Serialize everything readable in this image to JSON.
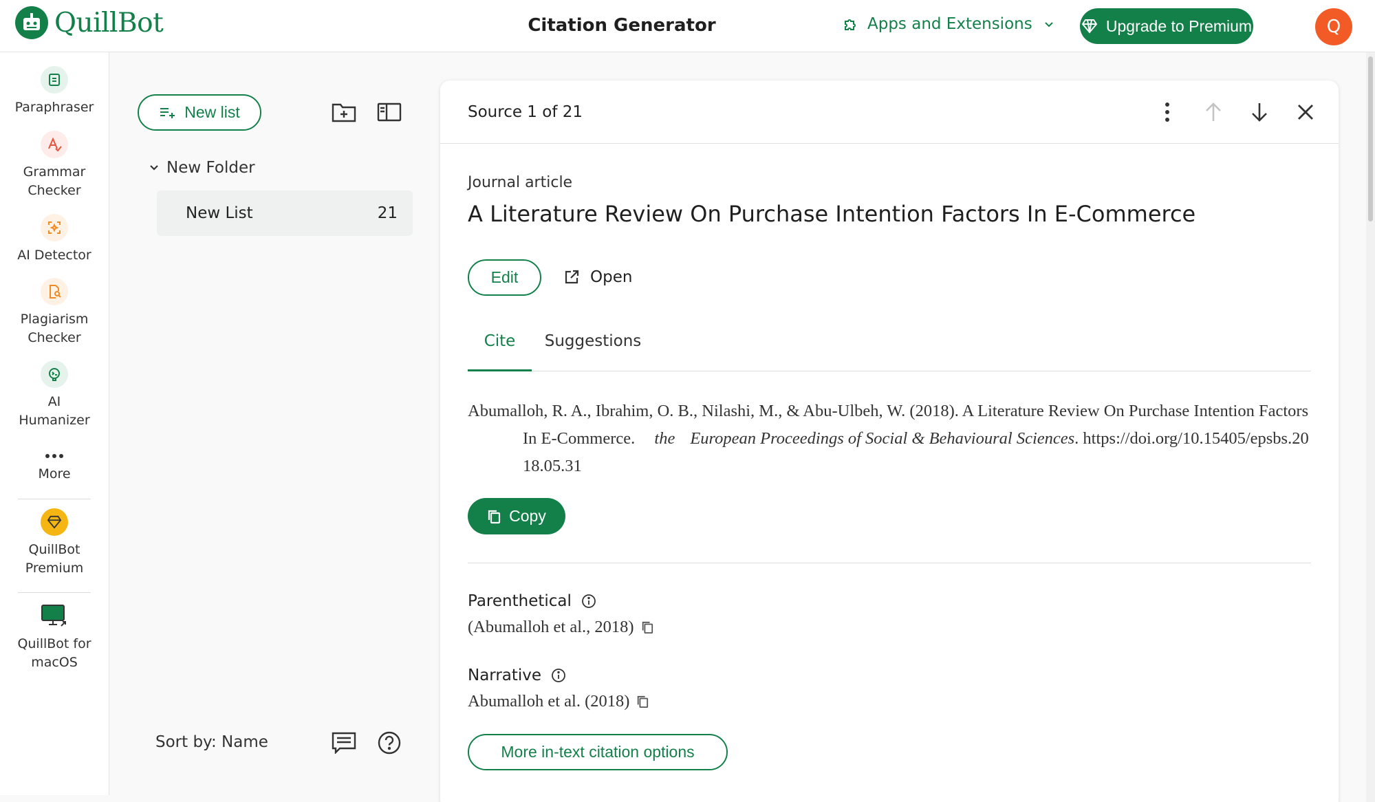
{
  "colors": {
    "accent": "#13804a",
    "avatar": "#f35b26",
    "premium": "#f5b512"
  },
  "header": {
    "brand": "QuillBot",
    "title": "Citation Generator",
    "apps_label": "Apps and Extensions",
    "upgrade_label": "Upgrade to Premium",
    "avatar_initial": "Q"
  },
  "rail": {
    "items": [
      {
        "label": "Paraphraser",
        "icon": "paraphraser-icon"
      },
      {
        "label": "Grammar\nChecker",
        "icon": "grammar-checker-icon"
      },
      {
        "label": "AI Detector",
        "icon": "ai-detector-icon"
      },
      {
        "label": "Plagiarism\nChecker",
        "icon": "plagiarism-checker-icon"
      },
      {
        "label": "AI\nHumanizer",
        "icon": "ai-humanizer-icon"
      },
      {
        "label": "More",
        "icon": "more-dots-icon"
      },
      {
        "label": "QuillBot\nPremium",
        "icon": "premium-diamond-icon"
      },
      {
        "label": "QuillBot for\nmacOS",
        "icon": "macos-app-icon"
      }
    ]
  },
  "lists": {
    "new_list_label": "New list",
    "folder_name": "New Folder",
    "list_name": "New List",
    "list_count": "21",
    "sort_label": "Sort by: Name"
  },
  "source": {
    "count_label": "Source 1 of 21",
    "type": "Journal article",
    "title": "A Literature Review On Purchase Intention Factors In E-Commerce",
    "edit_label": "Edit",
    "open_label": "Open",
    "tabs": [
      "Cite",
      "Suggestions"
    ],
    "citation": {
      "authors_year_title": "Abumalloh, R. A., Ibrahim, O. B., Nilashi, M., & Abu-Ulbeh, W. (2018). A Literature Review On Purchase Intention Factors In E-Commerce.",
      "journal_the": "the",
      "journal": "European Proceedings of Social & Behavioural Sciences",
      "doi": ". https://doi.org/10.15405/epsbs.2018.05.31"
    },
    "copy_label": "Copy",
    "parenthetical_label": "Parenthetical",
    "parenthetical_value": "(Abumalloh et al., 2018)",
    "narrative_label": "Narrative",
    "narrative_value": "Abumalloh et al. (2018)",
    "more_label": "More in-text citation options"
  }
}
